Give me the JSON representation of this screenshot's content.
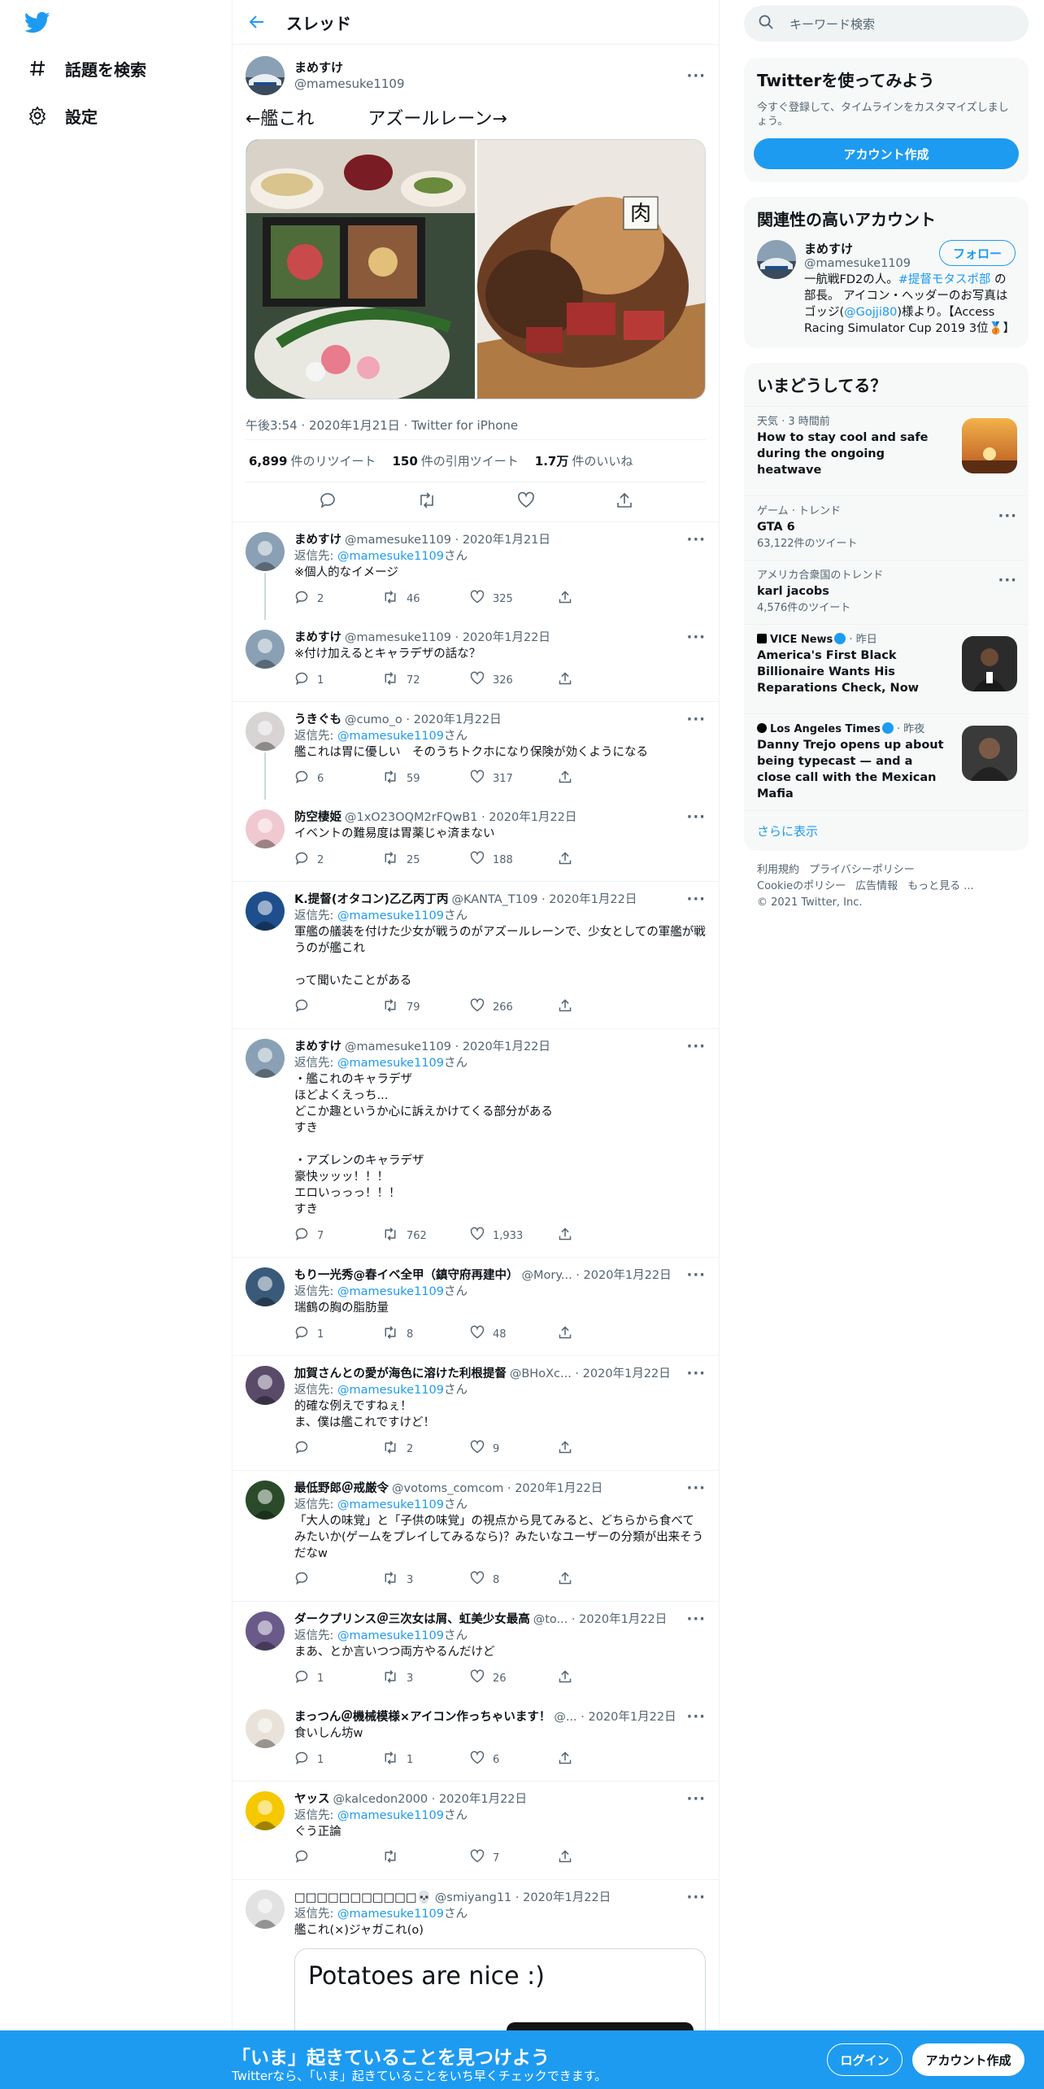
{
  "colors": {
    "accent": "#1d9bf0",
    "text": "#0f1419",
    "muted": "#536471"
  },
  "nav": {
    "explore": "話題を検索",
    "settings": "設定"
  },
  "header": {
    "title": "スレッド"
  },
  "focal": {
    "name": "まめすけ",
    "handle": "@mamesuke1109",
    "text": "←艦これ　　　アズールレーン→",
    "image_badge": "肉",
    "meta": "午後3:54 · 2020年1月21日 · Twitter for iPhone",
    "stats": {
      "retweets": "6,899",
      "retweets_label": "件のリツイート",
      "quotes": "150",
      "quotes_label": "件の引用ツイート",
      "likes": "1.7万",
      "likes_label": "件のいいね"
    }
  },
  "replies": [
    {
      "name": "まめすけ",
      "handle": "@mamesuke1109 · 2020年1月21日",
      "to_prefix": "返信先: ",
      "to": "@mamesuke1109",
      "to_suffix": "さん",
      "text": "※個人的なイメージ",
      "reply": "2",
      "rt": "46",
      "like": "325"
    },
    {
      "name": "まめすけ",
      "handle": "@mamesuke1109 · 2020年1月22日",
      "to_prefix": "",
      "to": "",
      "to_suffix": "",
      "text": "※付け加えるとキャラデザの話な？",
      "reply": "1",
      "rt": "72",
      "like": "326"
    },
    {
      "name": "うきぐも",
      "handle": "@cumo_o · 2020年1月22日",
      "to_prefix": "返信先: ",
      "to": "@mamesuke1109",
      "to_suffix": "さん",
      "text": "艦これは胃に優しい　そのうちトクホになり保険が効くようになる",
      "reply": "6",
      "rt": "59",
      "like": "317"
    },
    {
      "name": "防空棲姫",
      "handle": "@1xO23OQM2rFQwB1 · 2020年1月22日",
      "to_prefix": "",
      "to": "",
      "to_suffix": "",
      "text": "イベントの難易度は胃薬じゃ済まない",
      "reply": "2",
      "rt": "25",
      "like": "188"
    },
    {
      "name": "K.提督(オタコン)乙乙丙丁丙",
      "handle": "@KANTA_T109 · 2020年1月22日",
      "to_prefix": "返信先: ",
      "to": "@mamesuke1109",
      "to_suffix": "さん",
      "text": "軍艦の艤装を付けた少女が戦うのがアズールレーンで、少女としての軍艦が戦うのが艦これ\n\nって聞いたことがある",
      "reply": "",
      "rt": "79",
      "like": "266"
    },
    {
      "name": "まめすけ",
      "handle": "@mamesuke1109 · 2020年1月22日",
      "to_prefix": "返信先: ",
      "to": "@mamesuke1109",
      "to_suffix": "さん",
      "text": "・艦これのキャラデザ\nほどよくえっち...\nどこか趣というか心に訴えかけてくる部分がある\nすき\n\n・アズレンのキャラデザ\n豪快ッッッ！！！\nエロいっっっ！！！\nすき",
      "reply": "7",
      "rt": "762",
      "like": "1,933"
    },
    {
      "name": "もり一光秀@春イベ全甲（鎮守府再建中）",
      "handle": "@Mory... · 2020年1月22日",
      "to_prefix": "返信先: ",
      "to": "@mamesuke1109",
      "to_suffix": "さん",
      "text": "瑞鶴の胸の脂肪量",
      "reply": "1",
      "rt": "8",
      "like": "48"
    },
    {
      "name": "加賀さんとの愛が海色に溶けた利根提督",
      "handle": "@BHoXc... · 2020年1月22日",
      "to_prefix": "返信先: ",
      "to": "@mamesuke1109",
      "to_suffix": "さん",
      "text": "的確な例えですねぇ！\nま、僕は艦これですけど！",
      "reply": "",
      "rt": "2",
      "like": "9"
    },
    {
      "name": "最低野郎＠戒厳令",
      "handle": "@votoms_comcom · 2020年1月22日",
      "to_prefix": "返信先: ",
      "to": "@mamesuke1109",
      "to_suffix": "さん",
      "text": "「大人の味覚」と「子供の味覚」の視点から見てみると、どちらから食べてみたいか(ゲームをプレイしてみるなら)？みたいなユーザーの分類が出来そうだなw",
      "reply": "",
      "rt": "3",
      "like": "8"
    },
    {
      "name": "ダークプリンス＠三次女は屑、虹美少女最高",
      "handle": "@to... · 2020年1月22日",
      "to_prefix": "返信先: ",
      "to": "@mamesuke1109",
      "to_suffix": "さん",
      "text": "まあ、とか言いつつ両方やるんだけど",
      "reply": "1",
      "rt": "3",
      "like": "26"
    },
    {
      "name": "まっつん＠機械模様×アイコン作っちゃいます！",
      "handle": "@... · 2020年1月22日",
      "to_prefix": "",
      "to": "",
      "to_suffix": "",
      "text": "食いしん坊w",
      "reply": "1",
      "rt": "1",
      "like": "6"
    },
    {
      "name": "ヤッス",
      "handle": "@kalcedon2000 · 2020年1月22日",
      "to_prefix": "返信先: ",
      "to": "@mamesuke1109",
      "to_suffix": "さん",
      "text": "ぐう正論",
      "reply": "",
      "rt": "",
      "like": "7"
    },
    {
      "name": "□□□□□□□□□□□💀",
      "handle": "@smiyang11 · 2020年1月22日",
      "to_prefix": "返信先: ",
      "to": "@mamesuke1109",
      "to_suffix": "さん",
      "text": "艦これ(×)ジャガこれ(o)",
      "reply": "",
      "rt": "",
      "like": "",
      "card": "Potatoes are nice :)"
    }
  ],
  "search": {
    "placeholder": "キーワード検索"
  },
  "signup": {
    "title": "Twitterを使ってみよう",
    "sub": "今すぐ登録して、タイムラインをカスタマイズしましょう。",
    "button": "アカウント作成"
  },
  "related": {
    "title": "関連性の高いアカウント",
    "name": "まめすけ",
    "handle": "@mamesuke1109",
    "follow": "フォロー",
    "bio_a": "一航戦FD2の人。",
    "bio_tag": "#提督モタスポ部",
    "bio_b": " の部長。 アイコン・ヘッダーのお写真はゴッジ(",
    "bio_link": "@Gojji80",
    "bio_c": ")様より。【Access Racing Simulator Cup 2019 3位🥉】"
  },
  "trends": {
    "title": "いまどうしてる？",
    "items": [
      {
        "meta": "天気 · 3 時間前",
        "title": "How to stay cool and safe during the ongoing heatwave",
        "count": ""
      },
      {
        "meta": "ゲーム · トレンド",
        "title": "GTA 6",
        "count": "63,122件のツイート"
      },
      {
        "meta": "アメリカ合衆国のトレンド",
        "title": "karl jacobs",
        "count": "4,576件のツイート"
      },
      {
        "meta": "VICE News",
        "meta2": " · 昨日",
        "title": "America's First Black Billionaire Wants His Reparations Check, Now",
        "count": ""
      },
      {
        "meta": "Los Angeles Times",
        "meta2": " · 昨夜",
        "title": "Danny Trejo opens up about being typecast — and a close call with the Mexican Mafia",
        "count": ""
      }
    ],
    "show_more": "さらに表示"
  },
  "footer": {
    "terms": "利用規約",
    "privacy": "プライバシーポリシー",
    "cookie": "Cookieのポリシー",
    "ads": "広告情報",
    "more": "もっと見る ...",
    "copy": "© 2021 Twitter, Inc."
  },
  "bottom": {
    "title": "「いま」起きていることを見つけよう",
    "sub": "Twitterなら、「いま」起きていることをいち早くチェックできます。",
    "login": "ログイン",
    "signup": "アカウント作成"
  }
}
